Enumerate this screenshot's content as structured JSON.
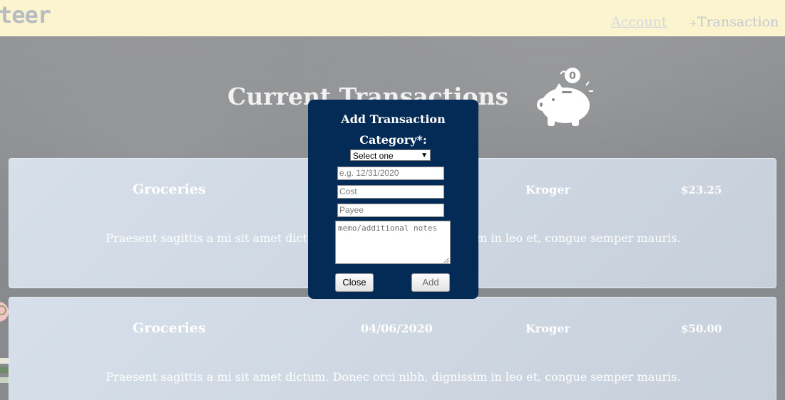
{
  "header": {
    "brand": "teer",
    "nav": {
      "account_label": "Account",
      "transaction_plus": "+",
      "transaction_label": "Transaction"
    }
  },
  "main": {
    "title": "Current Transactions",
    "piggy_coin": "0",
    "transactions": [
      {
        "category": "Groceries",
        "date": "",
        "payee": "Kroger",
        "cost": "$23.25",
        "memo": "Praesent sagittis a mi sit amet dictum. Donec orci nibh, dignissim in leo et, congue semper mauris."
      },
      {
        "category": "Groceries",
        "date": "04/06/2020",
        "payee": "Kroger",
        "cost": "$50.00",
        "memo": "Praesent sagittis a mi sit amet dictum. Donec orci nibh, dignissim in leo et, congue semper mauris."
      }
    ]
  },
  "modal": {
    "title": "Add Transaction",
    "category_label": "Category*:",
    "category_select_value": "Select one",
    "date_placeholder": "e.g. 12/31/2020",
    "cost_placeholder": "Cost",
    "payee_placeholder": "Payee",
    "memo_placeholder": "memo/additional notes",
    "close_label": "Close",
    "add_label": "Add"
  },
  "colors": {
    "topbar": "#fbf4cf",
    "modal_bg": "#032b55",
    "card_bg": "#d3dce7"
  }
}
